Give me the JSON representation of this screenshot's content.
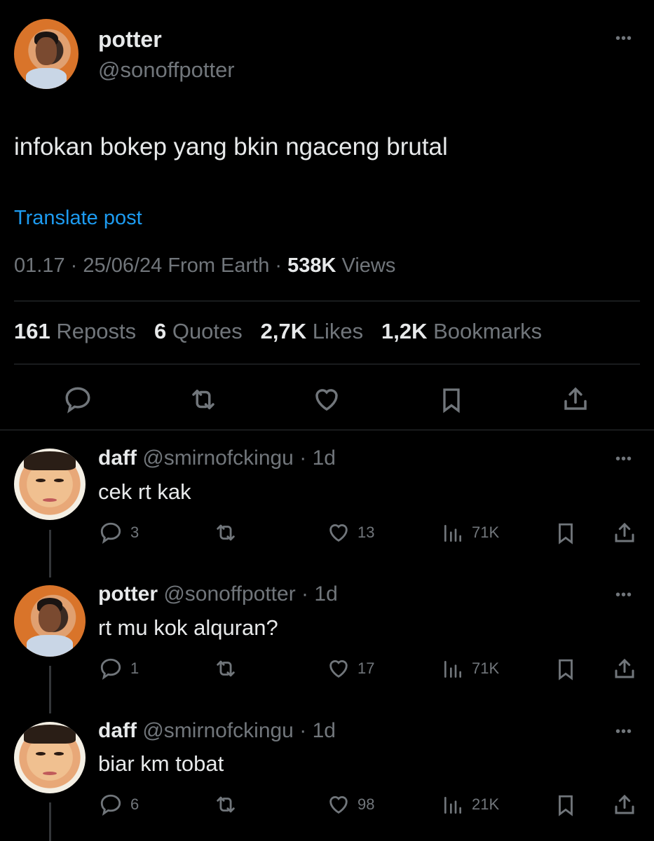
{
  "post": {
    "display_name": "potter",
    "handle": "@sonoffpotter",
    "text": "infokan bokep yang bkin ngaceng brutal",
    "translate_label": "Translate post",
    "time": "01.17",
    "date": "25/06/24",
    "source": "From Earth",
    "views_count": "538K",
    "views_label": "Views",
    "reposts_count": "161",
    "reposts_label": "Reposts",
    "quotes_count": "6",
    "quotes_label": "Quotes",
    "likes_count": "2,7K",
    "likes_label": "Likes",
    "bookmarks_count": "1,2K",
    "bookmarks_label": "Bookmarks",
    "more_label": "•••",
    "actions": [
      "reply-icon",
      "repost-icon",
      "like-icon",
      "bookmark-icon",
      "share-icon"
    ]
  },
  "replies": [
    {
      "display_name": "daff",
      "handle": "@smirnofckingu",
      "age": "1d",
      "text": "cek rt kak",
      "reply_count": "3",
      "like_count": "13",
      "views": "71K"
    },
    {
      "display_name": "potter",
      "handle": "@sonoffpotter",
      "age": "1d",
      "text": "rt mu kok alquran?",
      "reply_count": "1",
      "like_count": "17",
      "views": "71K"
    },
    {
      "display_name": "daff",
      "handle": "@smirnofckingu",
      "age": "1d",
      "text": "biar km tobat",
      "reply_count": "6",
      "like_count": "98",
      "views": "21K"
    }
  ],
  "separator": "·",
  "colors": {
    "background": "#000000",
    "text": "#e7e9ea",
    "muted": "#71767b",
    "link": "#1d9bf0",
    "divider": "#2f3336"
  }
}
